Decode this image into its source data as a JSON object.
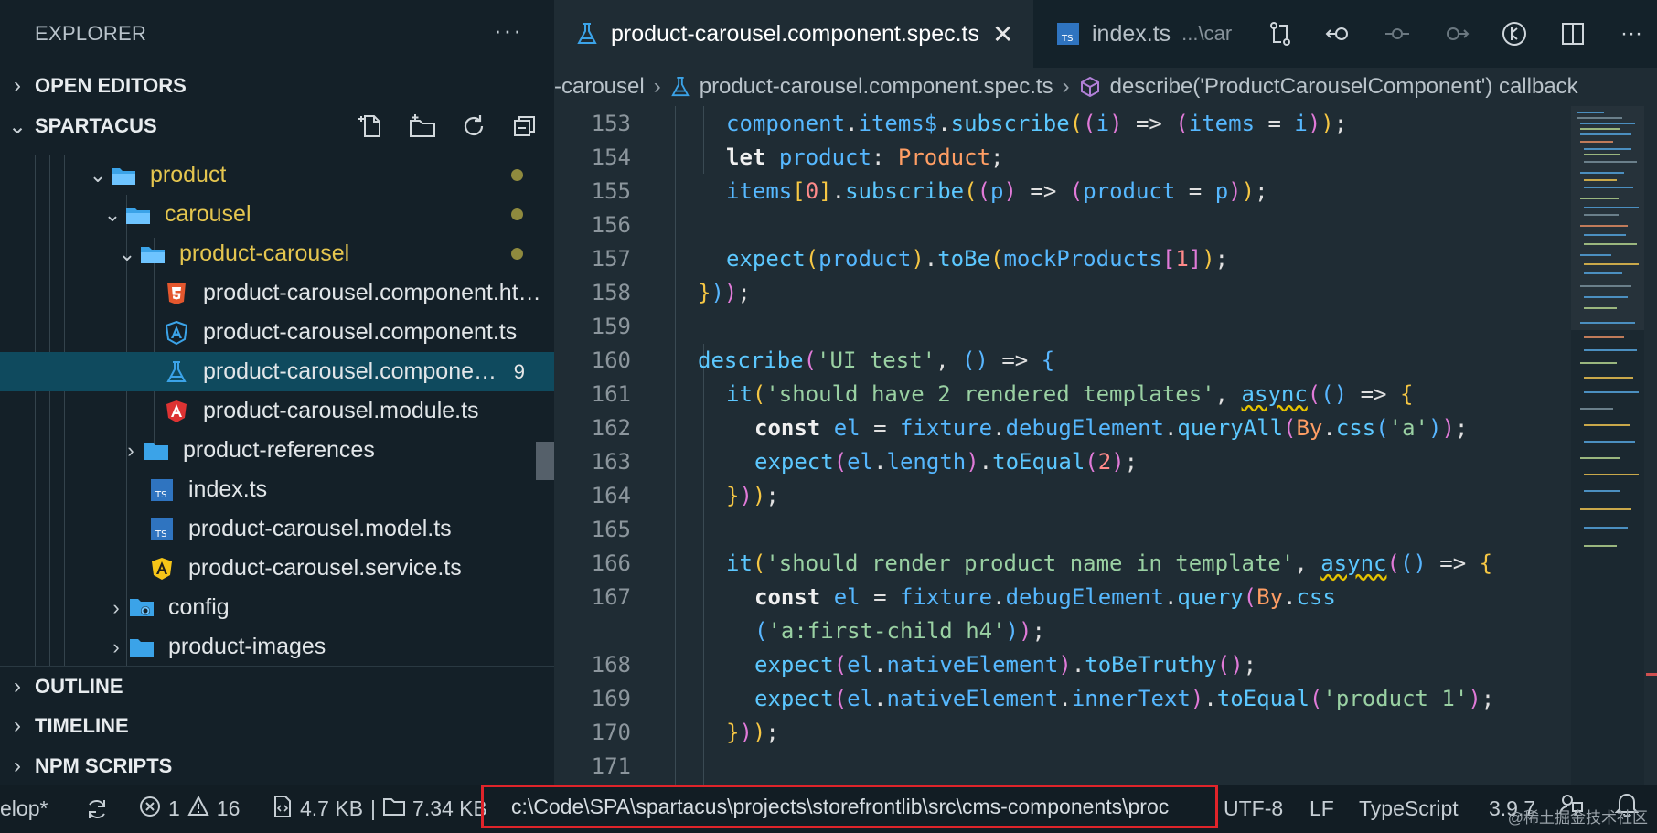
{
  "sidebar": {
    "title": "EXPLORER",
    "more": "···",
    "open_editors": "OPEN EDITORS",
    "project": "SPARTACUS",
    "tree": [
      {
        "label": "product",
        "kind": "folder-open",
        "modified": true
      },
      {
        "label": "carousel",
        "kind": "folder-open",
        "modified": true
      },
      {
        "label": "product-carousel",
        "kind": "folder-open",
        "modified": true
      },
      {
        "label": "product-carousel.component.ht…",
        "kind": "html-file"
      },
      {
        "label": "product-carousel.component.ts",
        "kind": "angular-component-file"
      },
      {
        "label": "product-carousel.compone…",
        "kind": "test-file",
        "badge": "9",
        "selected": true
      },
      {
        "label": "product-carousel.module.ts",
        "kind": "angular-module-file"
      },
      {
        "label": "product-references",
        "kind": "folder"
      },
      {
        "label": "index.ts",
        "kind": "ts-file"
      },
      {
        "label": "product-carousel.model.ts",
        "kind": "ts-file"
      },
      {
        "label": "product-carousel.service.ts",
        "kind": "angular-service-file"
      },
      {
        "label": "config",
        "kind": "config-folder"
      },
      {
        "label": "product-images",
        "kind": "folder"
      }
    ],
    "outline": "OUTLINE",
    "timeline": "TIMELINE",
    "npm_scripts": "NPM SCRIPTS"
  },
  "tabs": [
    {
      "label": "product-carousel.component.spec.ts",
      "active": true
    },
    {
      "label": "index.ts",
      "sub": "...\\car",
      "active": false
    }
  ],
  "breadcrumbs": {
    "folder": "-carousel",
    "file": "product-carousel.component.spec.ts",
    "symbol": "describe('ProductCarouselComponent') callback"
  },
  "code": {
    "line_numbers": [
      "153",
      "154",
      "155",
      "156",
      "157",
      "158",
      "159",
      "160",
      "161",
      "162",
      "163",
      "164",
      "165",
      "166",
      "167",
      "",
      "168",
      "169",
      "170",
      "171"
    ]
  },
  "statusbar": {
    "branch": "elop*",
    "errors": "1",
    "warnings": "16",
    "file_size": "4.7 KB",
    "folder_size": "7.34 KB",
    "separator": "|",
    "path": "c:\\Code\\SPA\\spartacus\\projects\\storefrontlib\\src\\cms-components\\proc",
    "encoding": "UTF-8",
    "eol": "LF",
    "language": "TypeScript",
    "version": "3.9.7",
    "watermark": "@稀土掘金技术社区"
  },
  "colors": {
    "accent_selected": "#0f4a5e",
    "modified": "#e5c64f",
    "highlight_box": "#e0242a"
  }
}
